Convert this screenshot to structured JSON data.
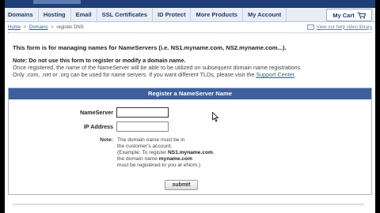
{
  "nav": {
    "items": [
      "Domains",
      "Hosting",
      "Email",
      "SSL Certificates",
      "ID Protect",
      "More Products",
      "My Account"
    ],
    "cart_label": "My Cart"
  },
  "breadcrumb": {
    "home": "Home",
    "domains": "Domains",
    "current": "register DNS",
    "separator": ">"
  },
  "help_video_link": "View our help video library",
  "intro": {
    "lead": "This form is for managing names for NameServers (i.e. NS1.myname.com, NS2.myname.com...).",
    "note_heading": "Note: Do not use this form to register or modify a domain name.",
    "note_line2": "Once registered, the name of the NameServer will be able to be utilized on subsequent domain name registrations.",
    "note_line3_prefix": "Only .com, .net or .org can be used for name servers. If you want different TLDs, please visit the",
    "support_link": "Support Center",
    "note_line3_suffix": "."
  },
  "form": {
    "title": "Register a NameServer Name",
    "nameserver_label": "NameServer",
    "nameserver_value": "",
    "ip_label": "IP Address",
    "ip_value": "",
    "note_label": "Note:",
    "note_line1": "The domain name must be in",
    "note_line2": "the customer's account.",
    "note_line3_prefix": "(Example: To register",
    "note_line3_bold": "NS1.myname.com",
    "note_line3_suffix": ",",
    "note_line4_prefix": "the domain name",
    "note_line4_bold": "myname.com",
    "note_line5": "must be registered to you at eNom.)",
    "submit_label": "submit"
  },
  "colors": {
    "header_blue": "#3d5f9c",
    "nav_text": "#1f3a6b",
    "link": "#355a9a"
  }
}
